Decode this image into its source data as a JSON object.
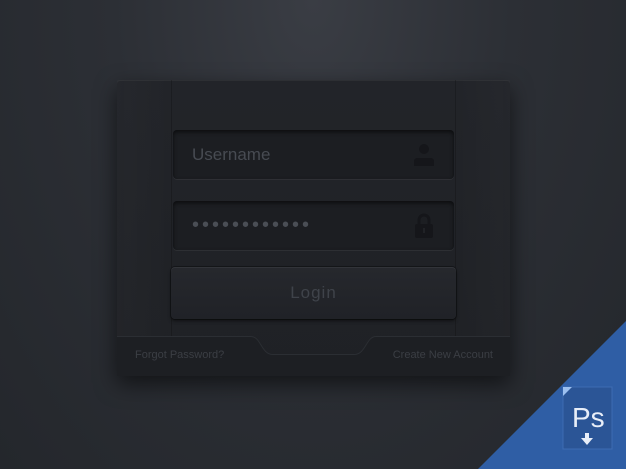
{
  "login_form": {
    "username_placeholder": "Username",
    "password_value": "••••••••••••",
    "login_label": "Login",
    "forgot_label": "Forgot Password?",
    "create_label": "Create New Account"
  },
  "icons": {
    "username_icon": "user-icon",
    "password_icon": "lock-icon"
  },
  "badge": {
    "text": "Ps",
    "icon": "download-arrow-icon"
  },
  "colors": {
    "background": "#2c2f35",
    "panel": "#212328",
    "badge": "#2f5ea5",
    "badge_text": "#e8eef8"
  }
}
